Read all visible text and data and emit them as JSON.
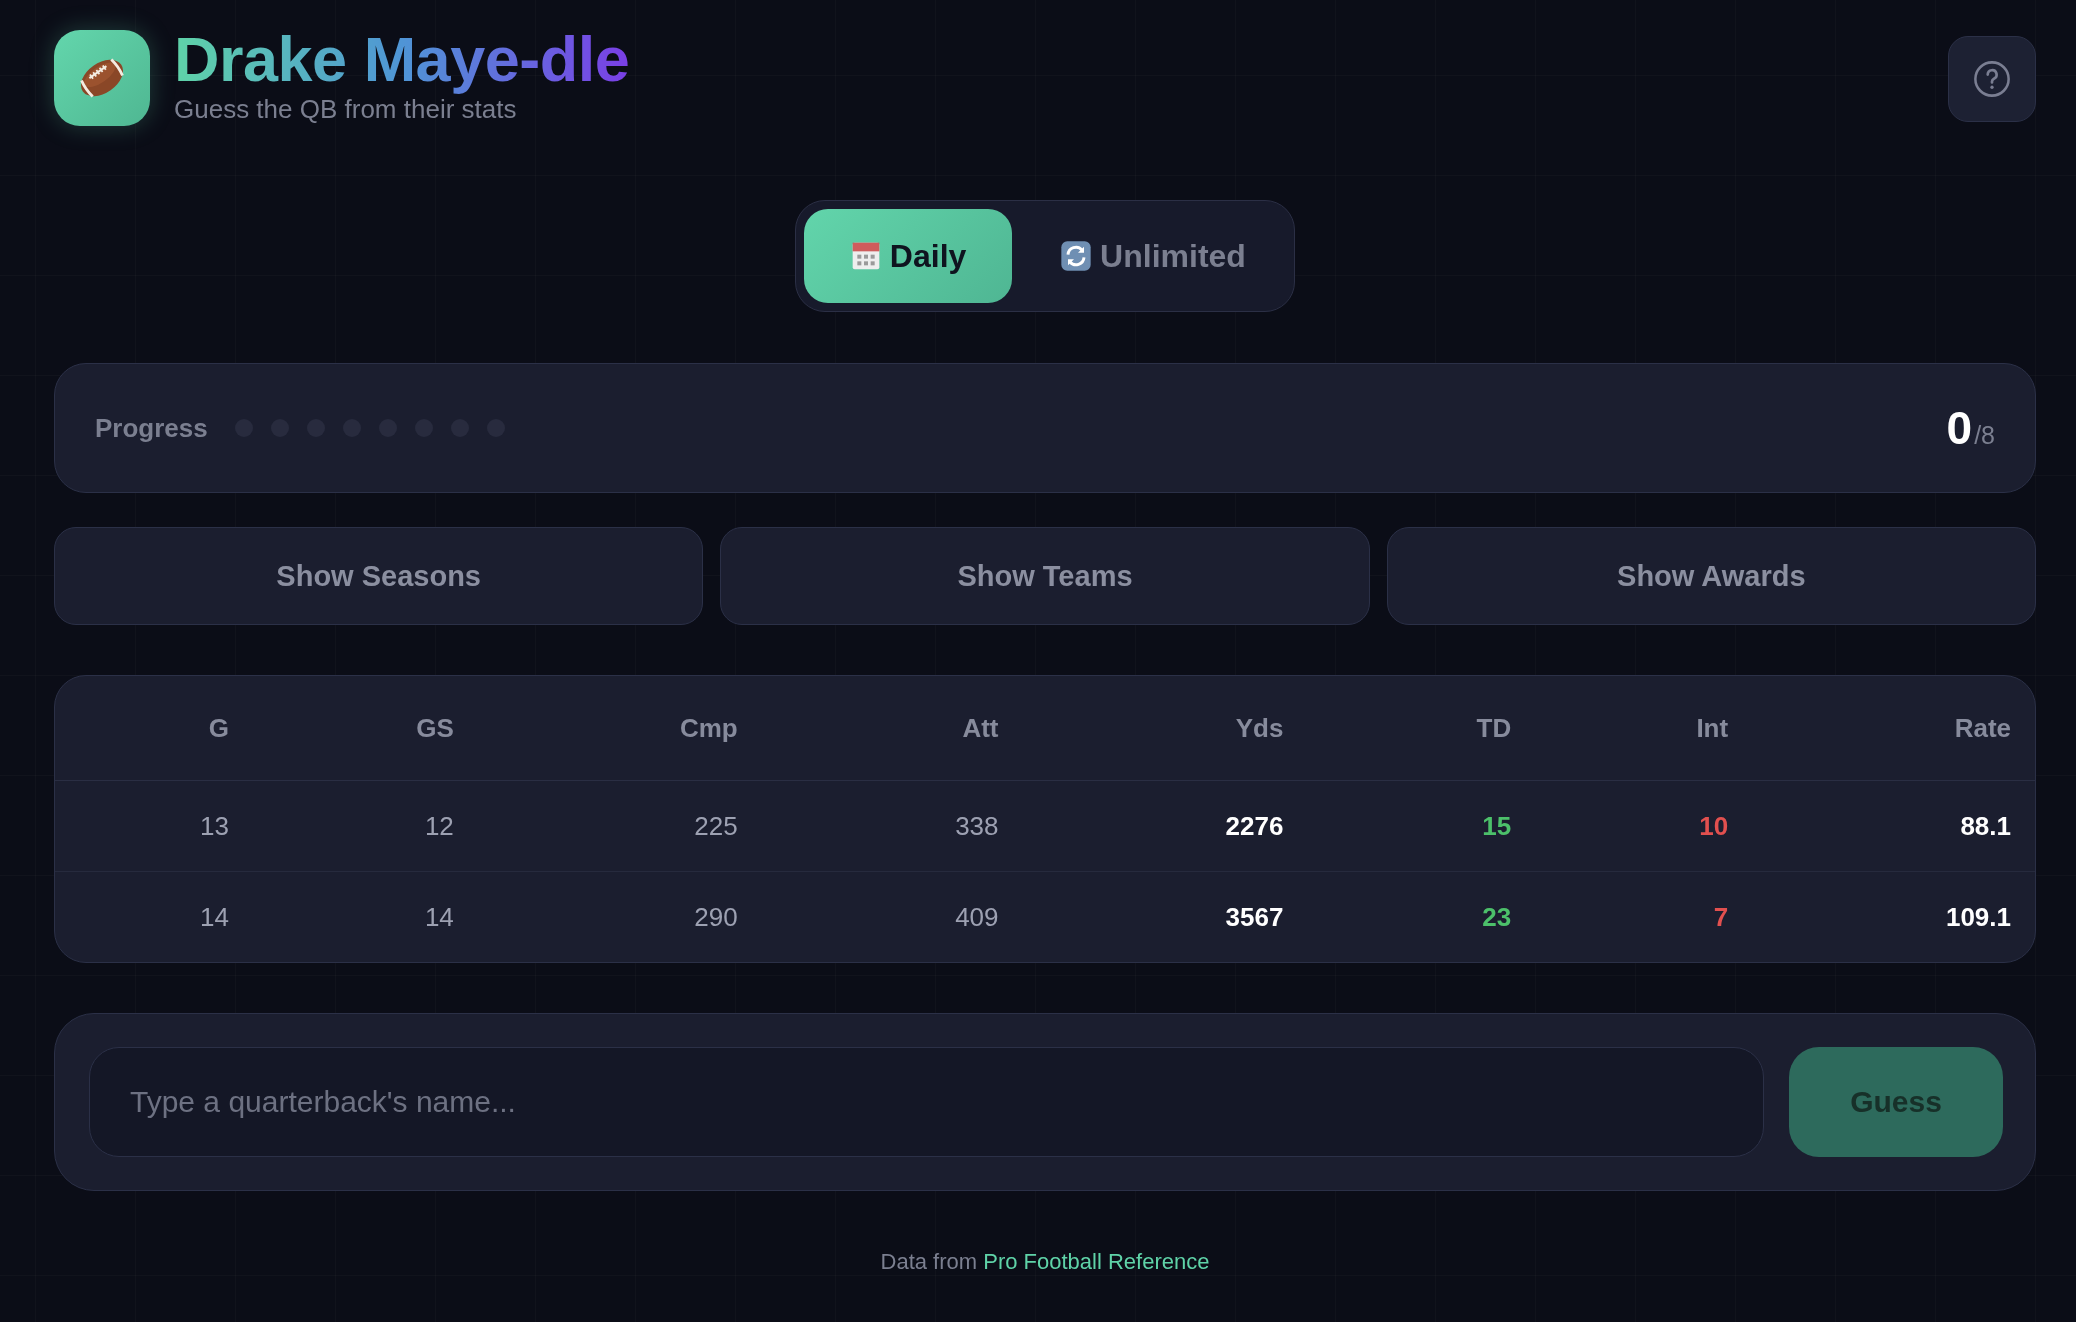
{
  "header": {
    "title": "Drake Maye-dle",
    "subtitle": "Guess the QB from their stats"
  },
  "tabs": [
    {
      "label": "Daily",
      "selected": true
    },
    {
      "label": "Unlimited",
      "selected": false
    }
  ],
  "progress": {
    "label": "Progress",
    "dots": [
      {
        "filled": false
      },
      {
        "filled": false
      },
      {
        "filled": false
      },
      {
        "filled": false
      },
      {
        "filled": false
      },
      {
        "filled": false
      },
      {
        "filled": false
      },
      {
        "filled": false
      }
    ],
    "count": "0",
    "total": "/8"
  },
  "hint_buttons": [
    "Show Seasons",
    "Show Teams",
    "Show Awards"
  ],
  "table": {
    "columns": [
      {
        "label": "G",
        "kind": "plain"
      },
      {
        "label": "GS",
        "kind": "plain"
      },
      {
        "label": "Cmp",
        "kind": "plain"
      },
      {
        "label": "Att",
        "kind": "plain"
      },
      {
        "label": "Yds",
        "kind": "strong"
      },
      {
        "label": "TD",
        "kind": "good"
      },
      {
        "label": "Int",
        "kind": "bad"
      },
      {
        "label": "Rate",
        "kind": "strong"
      }
    ],
    "rows": [
      [
        "13",
        "12",
        "225",
        "338",
        "2276",
        "15",
        "10",
        "88.1"
      ],
      [
        "14",
        "14",
        "290",
        "409",
        "3567",
        "23",
        "7",
        "109.1"
      ]
    ]
  },
  "guess": {
    "placeholder": "Type a quarterback's name...",
    "button": {
      "label": "Guess",
      "disabled": true
    }
  },
  "footer": {
    "text": "Data from",
    "link": "Pro Football Reference"
  }
}
